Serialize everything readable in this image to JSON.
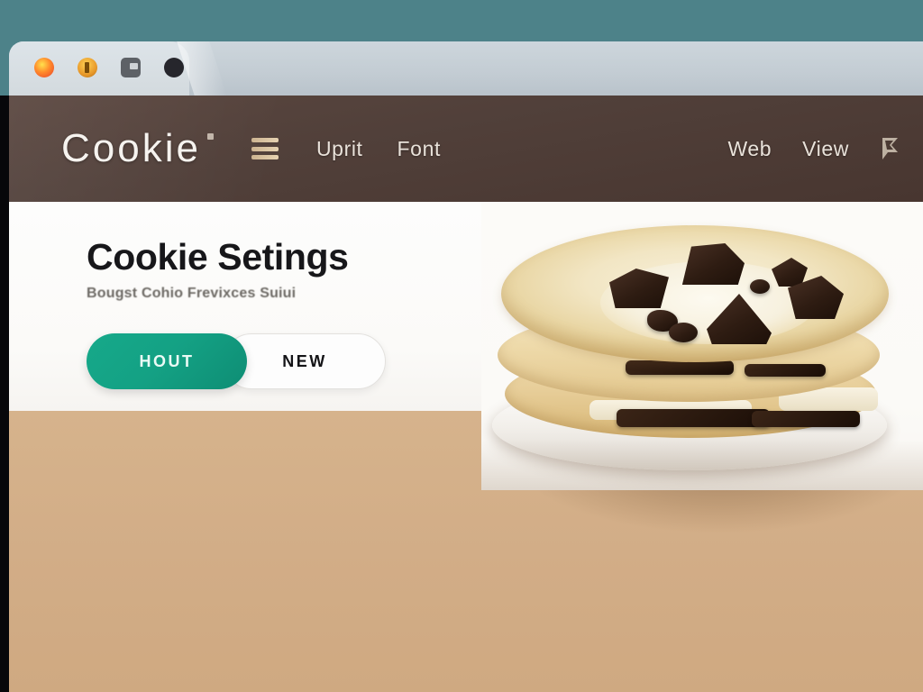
{
  "window": {
    "tab_icons": [
      "firefox-icon",
      "coin-icon",
      "camera-icon",
      "dot-icon"
    ]
  },
  "header": {
    "brand": "Cookie",
    "menu_icon": "hamburger-icon",
    "nav_left": [
      {
        "label": "Uprit"
      },
      {
        "label": "Font"
      }
    ],
    "nav_right": [
      {
        "label": "Web"
      },
      {
        "label": "View"
      }
    ],
    "flag_icon": "flag-icon",
    "bg_color": "#51403a",
    "text_color": "#e9e2da"
  },
  "main": {
    "title": "Cookie Setings",
    "subtitle": "Bougst Cohio Frevixces Suiui",
    "buttons": {
      "primary": "HOUT",
      "secondary": "NEW"
    },
    "card_bg": "#fbfaf8"
  },
  "colors": {
    "teal_backdrop": "#4d8289",
    "brown_header": "#51403a",
    "accent_green": "#14a184",
    "beige_surface": "#d2ad87",
    "left_edge": "#07070a",
    "tab_bar": "#c3ccd3"
  },
  "photo": {
    "alt": "stack-of-three-chocolate-chunk-cookies-on-white-plate"
  }
}
